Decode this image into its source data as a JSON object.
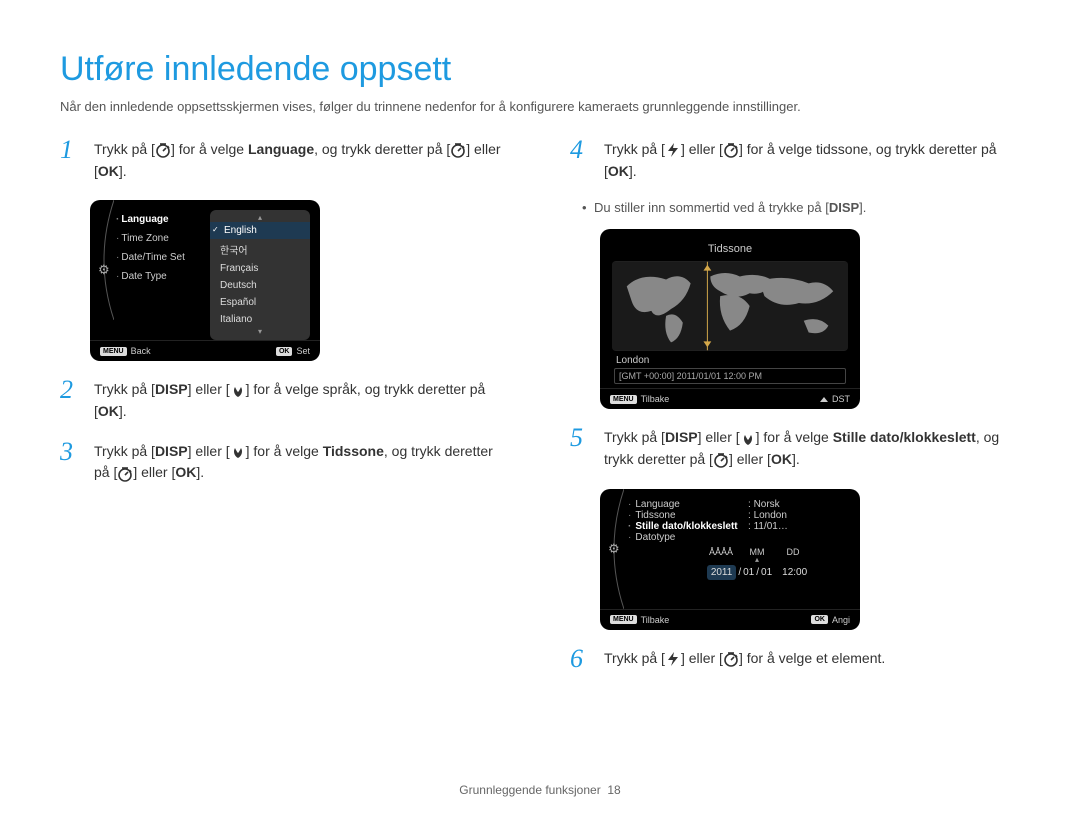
{
  "title": "Utføre innledende oppsett",
  "intro": "Når den innledende oppsettsskjermen vises, følger du trinnene nedenfor for å konfigurere kameraets grunnleggende innstillinger.",
  "steps": {
    "s1": {
      "pre": "Trykk på [",
      "mid1": "] for å velge ",
      "bold1": "Language",
      "mid2": ", og trykk deretter på [",
      "or": "] eller [",
      "end": "]."
    },
    "s2": {
      "pre": "Trykk på [",
      "or": "] eller [",
      "mid": "] for å velge språk, og trykk deretter på [",
      "end": "]."
    },
    "s3": {
      "pre": "Trykk på [",
      "or": "] eller [",
      "mid": "] for å velge ",
      "bold": "Tidssone",
      "mid2": ", og trykk deretter på [",
      "or2": "] eller [",
      "end": "]."
    },
    "s4": {
      "pre": "Trykk på [",
      "or": "] eller [",
      "mid": "] for å velge tidssone, og trykk deretter på [",
      "end": "]."
    },
    "s4_sub": {
      "pre": "Du stiller inn sommertid ved å trykke på [",
      "end": "]."
    },
    "s5": {
      "pre": "Trykk på [",
      "or": "] eller [",
      "mid": "] for å velge ",
      "bold": "Stille dato/klokkeslett",
      "mid2": ", og trykk deretter på [",
      "or2": "] eller [",
      "end": "]."
    },
    "s6": {
      "pre": "Trykk på [",
      "or": "] eller [",
      "end": "] for å velge et element."
    }
  },
  "device1": {
    "menu": {
      "language": "Language",
      "timezone": "Time Zone",
      "datetimeset": "Date/Time Set",
      "datetype": "Date Type"
    },
    "langs": {
      "english": "English",
      "korean": "한국어",
      "francais": "Français",
      "deutsch": "Deutsch",
      "espanol": "Español",
      "italiano": "Italiano"
    },
    "footer": {
      "menu": "MENU",
      "back": "Back",
      "ok": "OK",
      "set": "Set"
    }
  },
  "device2": {
    "title": "Tidssone",
    "city": "London",
    "gmt": "[GMT +00:00] 2011/01/01 12:00 PM",
    "footer": {
      "menu": "MENU",
      "back": "Tilbake",
      "dst": "DST"
    }
  },
  "device3": {
    "rows": {
      "language_l": "Language",
      "language_v": "Norsk",
      "tidssone_l": "Tidssone",
      "tidssone_v": "London",
      "stille_l": "Stille dato/klokkeslett",
      "stille_v": "11/01…",
      "datotype_l": "Datotype"
    },
    "date_header": {
      "y": "ÅÅÅÅ",
      "m": "MM",
      "d": "DD"
    },
    "date_vals": {
      "y": "2011",
      "sep": "/",
      "m": "01",
      "d": "01",
      "t": "12:00"
    },
    "footer": {
      "menu": "MENU",
      "back": "Tilbake",
      "ok": "OK",
      "set": "Angi"
    }
  },
  "footer": {
    "section": "Grunnleggende funksjoner",
    "page": "18"
  },
  "icons": {
    "disp": "DISP",
    "ok": "OK"
  }
}
